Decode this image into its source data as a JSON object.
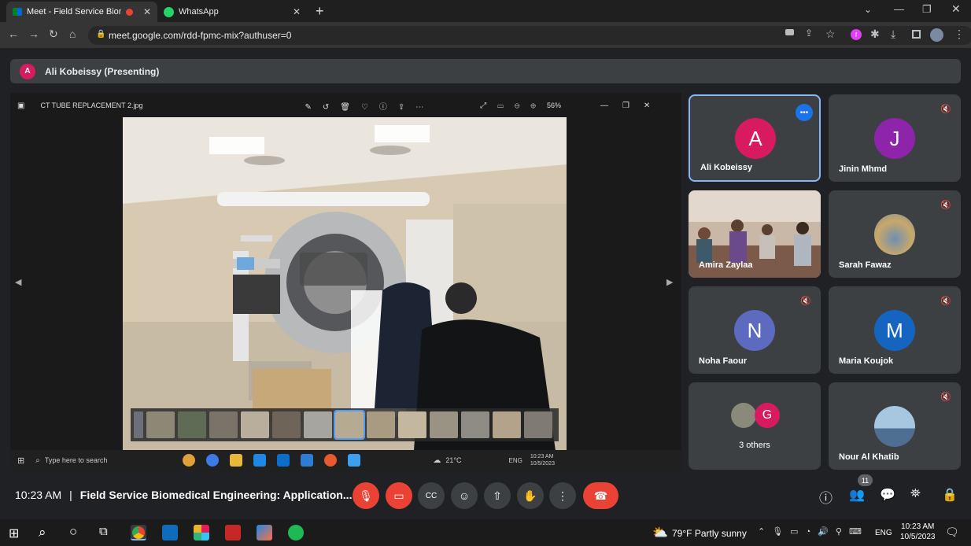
{
  "browser": {
    "tabs": [
      {
        "label": "Meet - Field Service Biomed",
        "active": true
      },
      {
        "label": "WhatsApp",
        "active": false
      }
    ],
    "url": "meet.google.com/rdd-fpmc-mix?authuser=0"
  },
  "presenting": {
    "initial": "A",
    "label": "Ali Kobeissy (Presenting)"
  },
  "viewer": {
    "filename": "CT TUBE REPLACEMENT 2.jpg",
    "zoom": "56%"
  },
  "shared_taskbar": {
    "search_placeholder": "Type here to search",
    "weather": "21°C",
    "lang": "ENG",
    "time": "10:23 AM",
    "date": "10/5/2023"
  },
  "participants": [
    {
      "name": "Ali Kobeissy",
      "initial": "A",
      "color": "#d81b60",
      "active": true
    },
    {
      "name": "Jinin Mhmd",
      "initial": "J",
      "color": "#8e24aa"
    },
    {
      "name": "Amira Zaylaa",
      "initial": "",
      "color": ""
    },
    {
      "name": "Sarah Fawaz",
      "initial": "",
      "color": ""
    },
    {
      "name": "Noha Faour",
      "initial": "N",
      "color": "#5c6bc0"
    },
    {
      "name": "Maria Koujok",
      "initial": "M",
      "color": "#1565c0"
    },
    {
      "name": "3 others",
      "initial": "G",
      "color": "#d81b60"
    },
    {
      "name": "Nour Al Khatib",
      "initial": "",
      "color": ""
    }
  ],
  "meeting": {
    "time": "10:23 AM",
    "separator": "|",
    "title": "Field Service Biomedical Engineering: Application...",
    "people_count": "11"
  },
  "windows_taskbar": {
    "weather": "79°F",
    "weather_text": "Partly sunny",
    "lang": "ENG",
    "time": "10:23 AM",
    "date": "10/5/2023"
  },
  "colors": {
    "meet_bg": "#202124",
    "tile_bg": "#3c4043",
    "end_call": "#ea4335",
    "active_border": "#8ab4f8"
  }
}
